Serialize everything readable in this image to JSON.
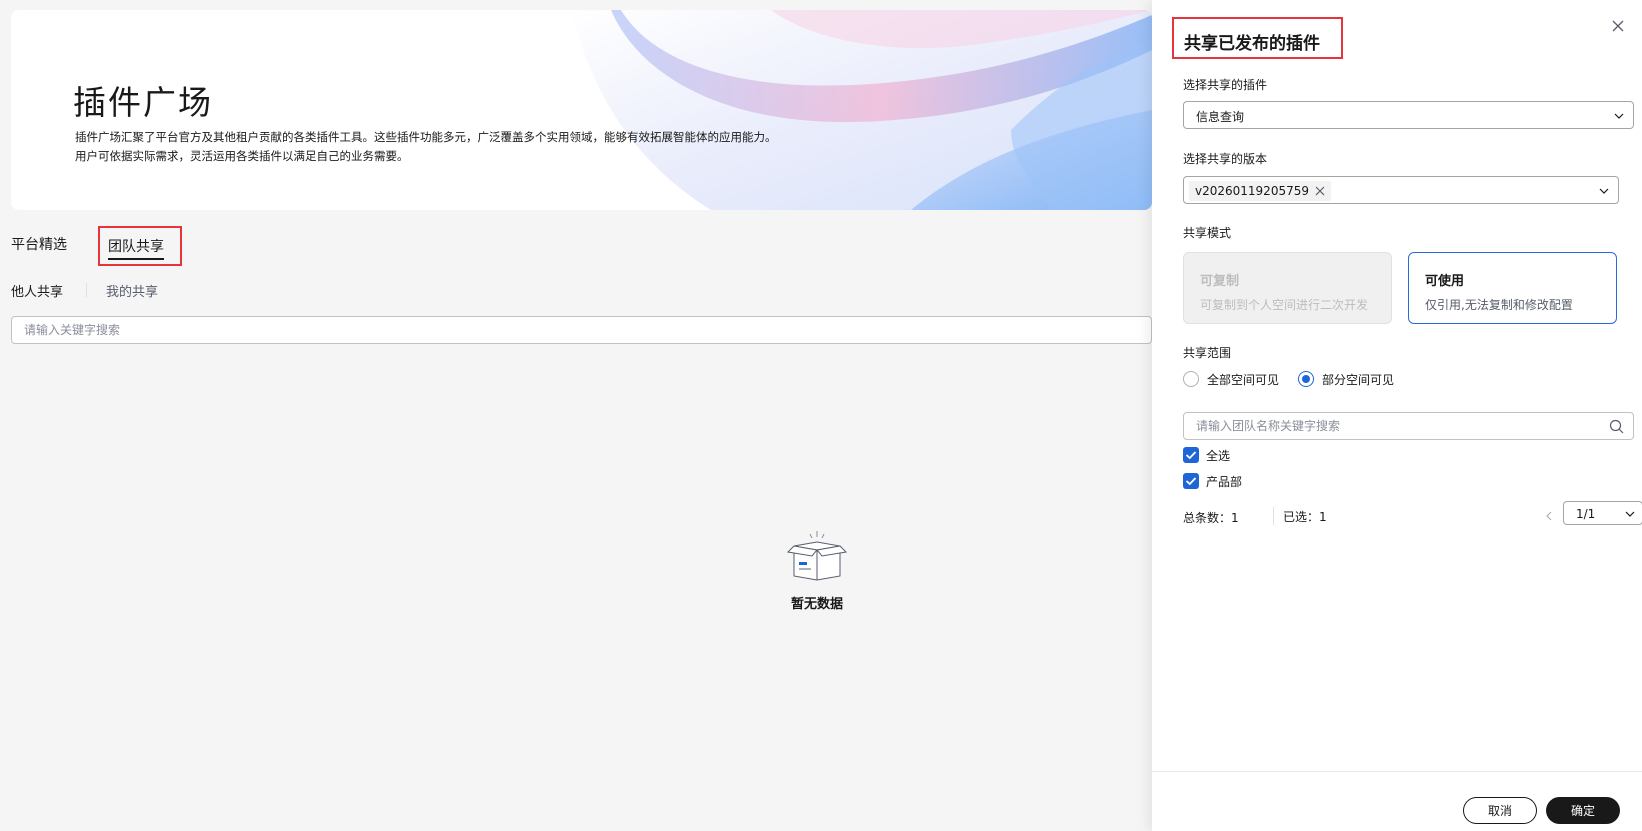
{
  "banner": {
    "title": "插件广场",
    "desc_line1": "插件广场汇聚了平台官方及其他租户贡献的各类插件工具。这些插件功能多元，广泛覆盖多个实用领域，能够有效拓展智能体的应用能力。",
    "desc_line2": "用户可依据实际需求，灵活运用各类插件以满足自己的业务需要。"
  },
  "tabs": {
    "platform": "平台精选",
    "team": "团队共享"
  },
  "subtabs": {
    "others": "他人共享",
    "mine": "我的共享"
  },
  "search": {
    "placeholder": "请输入关键字搜索"
  },
  "empty": {
    "text": "暂无数据"
  },
  "drawer": {
    "title": "共享已发布的插件",
    "plugin_label": "选择共享的插件",
    "plugin_value": "信息查询",
    "version_label": "选择共享的版本",
    "version_tag": "v20260119205759",
    "mode_label": "共享模式",
    "mode_copy_title": "可复制",
    "mode_copy_desc": "可复制到个人空间进行二次开发",
    "mode_use_title": "可使用",
    "mode_use_desc": "仅引用,无法复制和修改配置",
    "scope_label": "共享范围",
    "scope_all": "全部空间可见",
    "scope_partial": "部分空间可见",
    "team_search_placeholder": "请输入团队名称关键字搜索",
    "select_all": "全选",
    "team_item": "产品部",
    "total": "总条数：1",
    "selected": "已选：1",
    "page": "1/1",
    "cancel": "取消",
    "confirm": "确定"
  },
  "colors": {
    "accent": "#1e66d8",
    "highlight_box": "#e5343a",
    "primary_button": "#191919"
  }
}
